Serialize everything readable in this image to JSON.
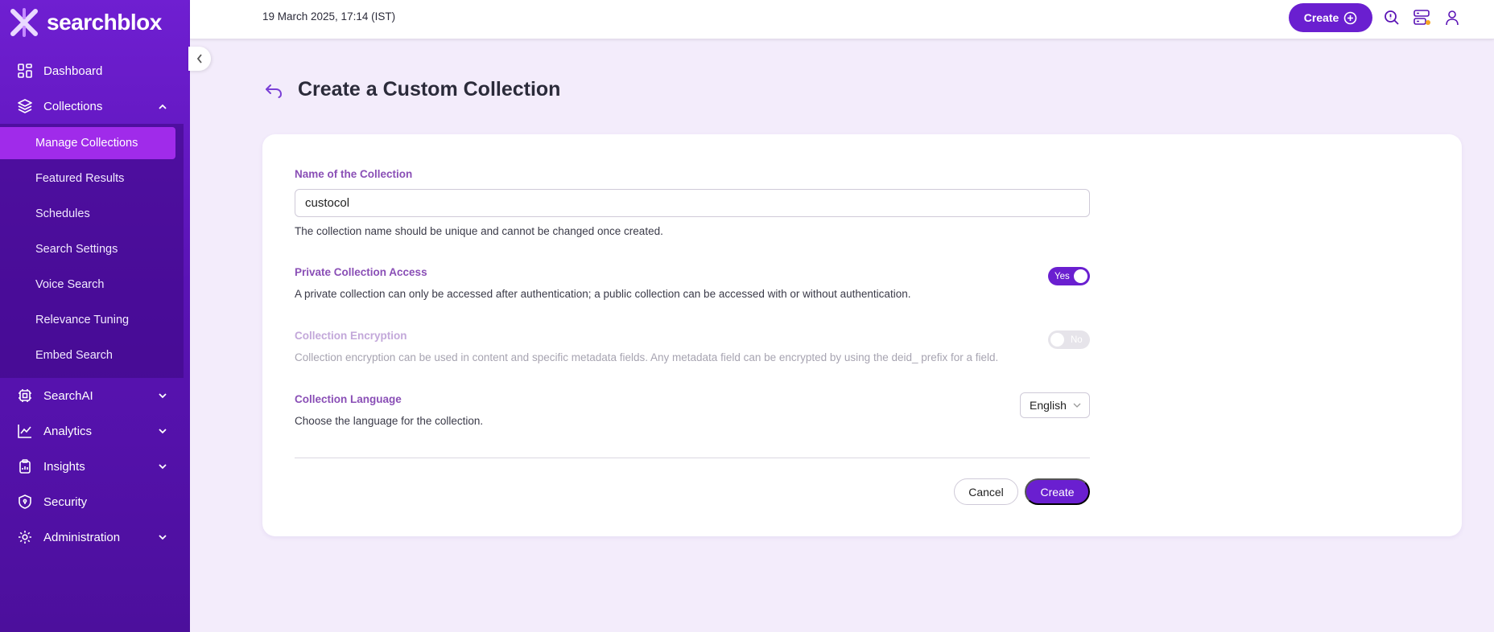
{
  "brand": {
    "name": "searchblox",
    "accent": "#6a1fd0"
  },
  "topbar": {
    "datetime": "19 March 2025, 17:14 (IST)",
    "create_label": "Create",
    "icons": [
      "search-icon",
      "server-status-icon",
      "user-icon"
    ]
  },
  "sidebar": {
    "items": [
      {
        "label": "Dashboard",
        "icon": "dashboard-icon"
      },
      {
        "label": "Collections",
        "icon": "layers-icon",
        "expanded": true
      },
      {
        "label": "SearchAI",
        "icon": "chip-icon"
      },
      {
        "label": "Analytics",
        "icon": "analytics-icon"
      },
      {
        "label": "Insights",
        "icon": "clipboard-icon"
      },
      {
        "label": "Security",
        "icon": "shield-icon"
      },
      {
        "label": "Administration",
        "icon": "gear-icon"
      }
    ],
    "collections_sub": [
      {
        "label": "Manage Collections",
        "active": true
      },
      {
        "label": "Featured Results"
      },
      {
        "label": "Schedules"
      },
      {
        "label": "Search Settings"
      },
      {
        "label": "Voice Search"
      },
      {
        "label": "Relevance Tuning"
      },
      {
        "label": "Embed Search"
      }
    ]
  },
  "page": {
    "title": "Create a Custom Collection"
  },
  "form": {
    "name": {
      "label": "Name of the Collection",
      "value": "custocol",
      "help": "The collection name should be unique and cannot be changed once created."
    },
    "private": {
      "label": "Private Collection Access",
      "desc": "A private collection can only be accessed after authentication; a public collection can be accessed with or without authentication.",
      "toggle": "Yes",
      "enabled": true
    },
    "encryption": {
      "label": "Collection Encryption",
      "desc": "Collection encryption can be used in content and specific metadata fields. Any metadata field can be encrypted by using the deid_ prefix for a field.",
      "toggle": "No",
      "disabled": true
    },
    "language": {
      "label": "Collection Language",
      "desc": "Choose the language for the collection.",
      "selected": "English"
    },
    "cancel_label": "Cancel",
    "create_label": "Create"
  }
}
